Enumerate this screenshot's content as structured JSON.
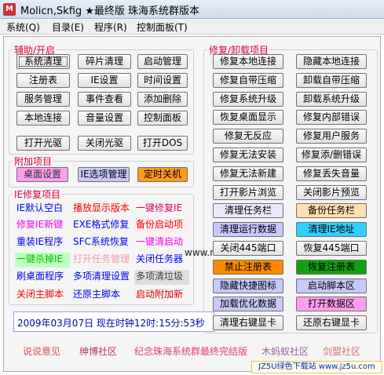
{
  "window": {
    "title": "Molicn,Skfig ★最终版 珠海系统群版本"
  },
  "menu": [
    "系统(Q)",
    "目录(E)",
    "程序(R)",
    "控制面板(T)"
  ],
  "groups": {
    "aux": "辅助/开启",
    "repair": "修复/卸载项目",
    "attach": "附加项目",
    "ie": "IE修复项目"
  },
  "aux_buttons": [
    "系统清理",
    "碎片清理",
    "启动管理",
    "注册表",
    "IE设置",
    "时间设置",
    "服务管理",
    "事件查看",
    "添加删除",
    "本地连接",
    "音量设置",
    "控制面板",
    "打开光驱",
    "关闭光驱",
    "打开DOS"
  ],
  "attach_buttons": [
    "桌面设置",
    "IE选项管理",
    "定时关机"
  ],
  "ie_buttons": [
    "IE默认空白",
    "播放显示版本",
    "一键修复IE",
    "修复IE新键",
    "EXE格式修复",
    "备份启动项",
    "重装IE程序",
    "SFC系统恢复",
    "一键清启动",
    "一键杀掉IE",
    "打开任务管理",
    "关闭任务器",
    "刷桌面程序",
    "多项清理设置",
    "多项清垃圾",
    "关闭主脚本",
    "还原主脚本",
    "启动附加新"
  ],
  "repair_buttons": [
    "修复本地连接",
    "隐藏本地连接",
    "修复自带压缩",
    "卸载自带压缩",
    "修复系统升级",
    "卸载系统升级",
    "恢复桌面显示",
    "修复内部错误",
    "修复无反应",
    "修复用户服务",
    "修复无法安装",
    "修复添/删错误",
    "修复无法新建",
    "修复丢失音量",
    "打开影片浏览",
    "关闭影片预览",
    "清理任务栏",
    "备份任务栏",
    "清理运行数据",
    "清理IE地址",
    "关闭445端口",
    "恢复445端口",
    "禁止注册表",
    "恢复注册表",
    "隐藏快捷图标",
    "启动脚本区",
    "加载优化数据",
    "打开数据区",
    "清理右键显卡",
    "还原右键显卡"
  ],
  "status": "2009年03月07日 现在时钟12时:15分:53秒",
  "url_overlay": "www.m",
  "links": [
    "说说意见",
    "绅博社区",
    "纪念珠海系统群最终完结版",
    "木蚂蚁社区",
    "剑盟社区"
  ],
  "watermark": "JZ5U绿色下载站 www.jz5u.com",
  "colors": {
    "accent": "#e0003b",
    "link_blue": "#0000c0"
  }
}
